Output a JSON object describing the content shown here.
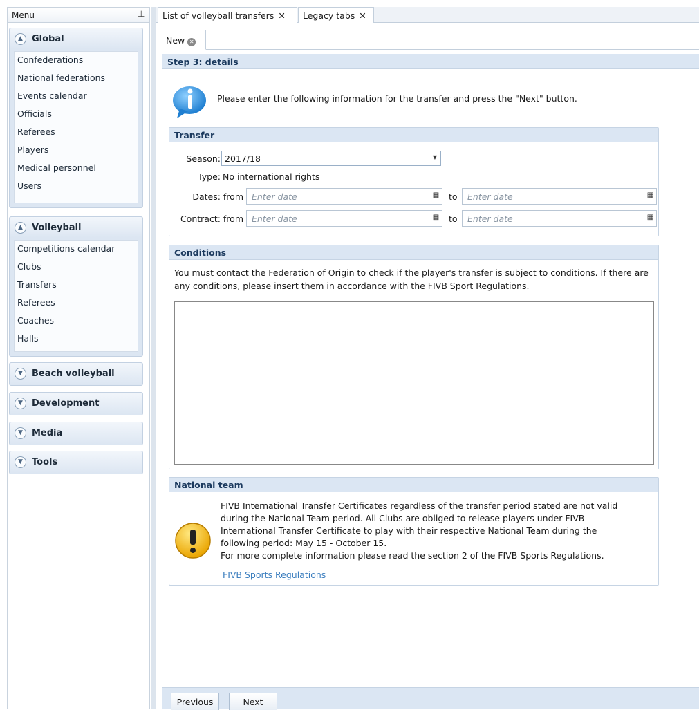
{
  "menu": {
    "title": "Menu",
    "pin_icon": "pin-icon",
    "groups": [
      {
        "title": "Global",
        "expanded": true,
        "items": [
          "Confederations",
          "National federations",
          "Events calendar",
          "Officials",
          "Referees",
          "Players",
          "Medical personnel",
          "Users"
        ]
      },
      {
        "title": "Volleyball",
        "expanded": true,
        "items": [
          "Competitions calendar",
          "Clubs",
          "Transfers",
          "Referees",
          "Coaches",
          "Halls"
        ]
      },
      {
        "title": "Beach volleyball",
        "expanded": false,
        "items": []
      },
      {
        "title": "Development",
        "expanded": false,
        "items": []
      },
      {
        "title": "Media",
        "expanded": false,
        "items": []
      },
      {
        "title": "Tools",
        "expanded": false,
        "items": []
      }
    ]
  },
  "tabs": [
    {
      "label": "List of volleyball transfers",
      "close": "✕"
    },
    {
      "label": "Legacy tabs",
      "close": "✕"
    }
  ],
  "inner_tab": {
    "label": "New"
  },
  "step": {
    "title": "Step 3: details",
    "info_text": "Please enter the following information for the transfer and press the \"Next\" button."
  },
  "transfer": {
    "title": "Transfer",
    "season_label": "Season:",
    "season_value": "2017/18",
    "type_label": "Type:",
    "type_value": "No international rights",
    "dates_label": "Dates: from",
    "contract_label": "Contract: from",
    "to_label": "to",
    "date_placeholder": "Enter date"
  },
  "conditions": {
    "title": "Conditions",
    "text": "You must contact the Federation of Origin to check if the player's transfer is subject to conditions. If there are any conditions, please insert them in accordance with the FIVB Sport Regulations.",
    "textarea_value": ""
  },
  "national_team": {
    "title": "National team",
    "text_lines": [
      "FIVB International Transfer Certificates regardless of the transfer period stated are not valid",
      "during the National Team period. All Clubs are obliged to release players under FIVB",
      "International Transfer Certificate to play with their respective National Team during the",
      "following period: May 15 - October 15.",
      "For more complete information please read the section 2 of the FIVB Sports Regulations."
    ],
    "link": "FIVB Sports Regulations"
  },
  "buttons": {
    "previous": "Previous",
    "next": "Next"
  },
  "colors": {
    "header_bg": "#dbe6f3",
    "header_text": "#1c3a5e",
    "link": "#3d7fbf",
    "warning": "#f2b600"
  }
}
